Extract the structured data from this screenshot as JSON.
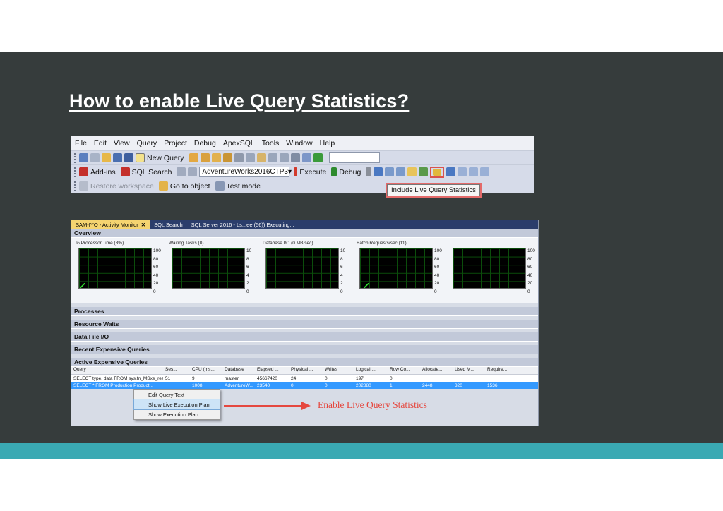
{
  "slide": {
    "title": "How to enable Live Query Statistics?"
  },
  "colors": {
    "panel_bg": "#363c3c",
    "accent_bar": "#3aa9b3",
    "highlight_red": "#e5483f"
  },
  "toolbar_screenshot": {
    "menu": [
      "File",
      "Edit",
      "View",
      "Query",
      "Project",
      "Debug",
      "ApexSQL",
      "Tools",
      "Window",
      "Help"
    ],
    "row1": {
      "new_query": "New Query"
    },
    "row2": {
      "add_ins": "Add-ins",
      "sql_search": "SQL Search",
      "database": "AdventureWorks2016CTP3",
      "execute": "Execute",
      "debug": "Debug"
    },
    "row3": {
      "restore_workspace": "Restore workspace",
      "go_to_object": "Go to object",
      "test_mode": "Test mode"
    },
    "tooltip": "Include Live Query Statistics"
  },
  "monitor_screenshot": {
    "tabs": [
      "SAM-IYO - Activity Monitor",
      "SQL Search",
      "SQL Server 2016 - Ls...ee (56)) Executing..."
    ],
    "sections": {
      "overview": "Overview",
      "processes": "Processes",
      "resource_waits": "Resource Waits",
      "data_file_io": "Data File I/O",
      "recent_expensive": "Recent Expensive Queries",
      "active_expensive": "Active Expensive Queries"
    },
    "graphs": [
      {
        "label": "% Processor Time (3%)",
        "scale": [
          "100",
          "80",
          "60",
          "40",
          "20",
          "0"
        ]
      },
      {
        "label": "Waiting Tasks (0)",
        "scale": [
          "10",
          "8",
          "6",
          "4",
          "2",
          "0"
        ]
      },
      {
        "label": "Database I/O (0 MB/sec)",
        "scale": [
          "10",
          "8",
          "6",
          "4",
          "2",
          "0"
        ]
      },
      {
        "label": "Batch Requests/sec (11)",
        "scale": [
          "100",
          "80",
          "60",
          "40",
          "20",
          "0"
        ]
      },
      {
        "label": "",
        "scale": [
          "100",
          "80",
          "60",
          "40",
          "20",
          "0"
        ]
      }
    ],
    "grid": {
      "headers": [
        "Query",
        "Ses...",
        "CPU (ms...",
        "Database",
        "Elapsed ...",
        "Physical ...",
        "Writes",
        "Logical ...",
        "Row Co...",
        "Allocate...",
        "Used M...",
        "Require..."
      ],
      "rows": [
        [
          "SELECT type, data FROM sys.fn_MSxe_read_...",
          "51",
          "9",
          "master",
          "45667420",
          "24",
          "0",
          "197",
          "0",
          "",
          "",
          ""
        ],
        [
          "SELECT * FROM Production.Product...",
          "",
          "1008",
          "AdventureW...",
          "23540",
          "0",
          "0",
          "202880",
          "1",
          "2448",
          "320",
          "1536"
        ]
      ]
    },
    "context_menu": [
      "Edit Query Text",
      "Show Live Execution Plan",
      "Show Execution Plan"
    ],
    "annotation": "Enable Live Query Statistics"
  }
}
